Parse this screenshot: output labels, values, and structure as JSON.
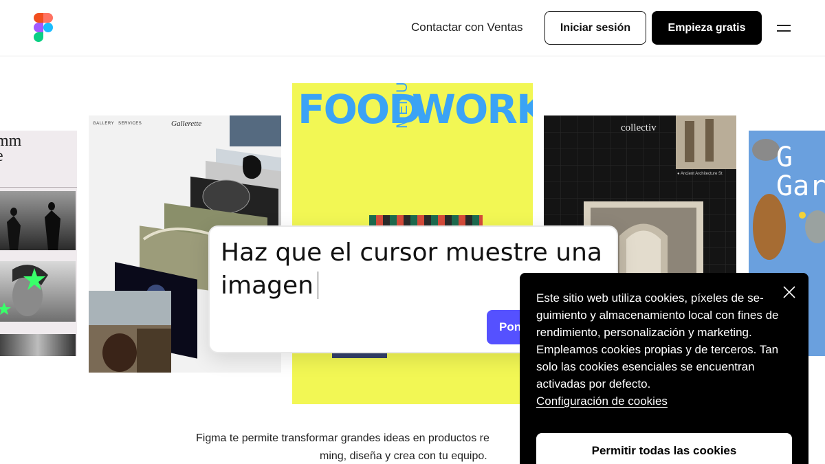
{
  "header": {
    "nav_contact_sales": "Contactar con Ventas",
    "login_label": "Iniciar sesión",
    "start_label": "Empieza gratis"
  },
  "gallery": {
    "left_card_heading": "mm\ne",
    "gallerette_nav": [
      "GALLERY",
      "SERVICES"
    ],
    "gallerette_title": "Gallerette",
    "food_left": "FOOD",
    "food_menu": "MENU",
    "food_right": "WORKS",
    "collectiv_title": "collectiv",
    "collectiv_caption": "● Ancient Architecture St",
    "right_card_text": "G\nGar"
  },
  "prompt": {
    "text": "Haz que el cursor muestre una imagen",
    "button_label": "Pon"
  },
  "tagline": {
    "line1": "Figma te permite transformar grandes ideas en productos re",
    "line2": "ming, diseña y crea con tu equipo."
  },
  "cookie_banner": {
    "text": "Este sitio web utiliza cookies, píxeles de se­guimiento y almacenamiento local con fines de rendimiento, personalización y marke­ting. Empleamos cookies propias y de ter­ceros. Tan solo las cookies esenciales se encuentran activadas por defecto.",
    "settings_link": "Configuración de cookies",
    "accept_label": "Permitir todas las cookies"
  },
  "colors": {
    "figma_red": "#f24e1e",
    "figma_orange": "#ff7262",
    "figma_purple": "#a259ff",
    "figma_blue": "#1abcfe",
    "figma_green": "#0acf83",
    "prompt_button": "#5551ff",
    "food_background": "#f2f754",
    "food_text": "#3ba3f5"
  }
}
